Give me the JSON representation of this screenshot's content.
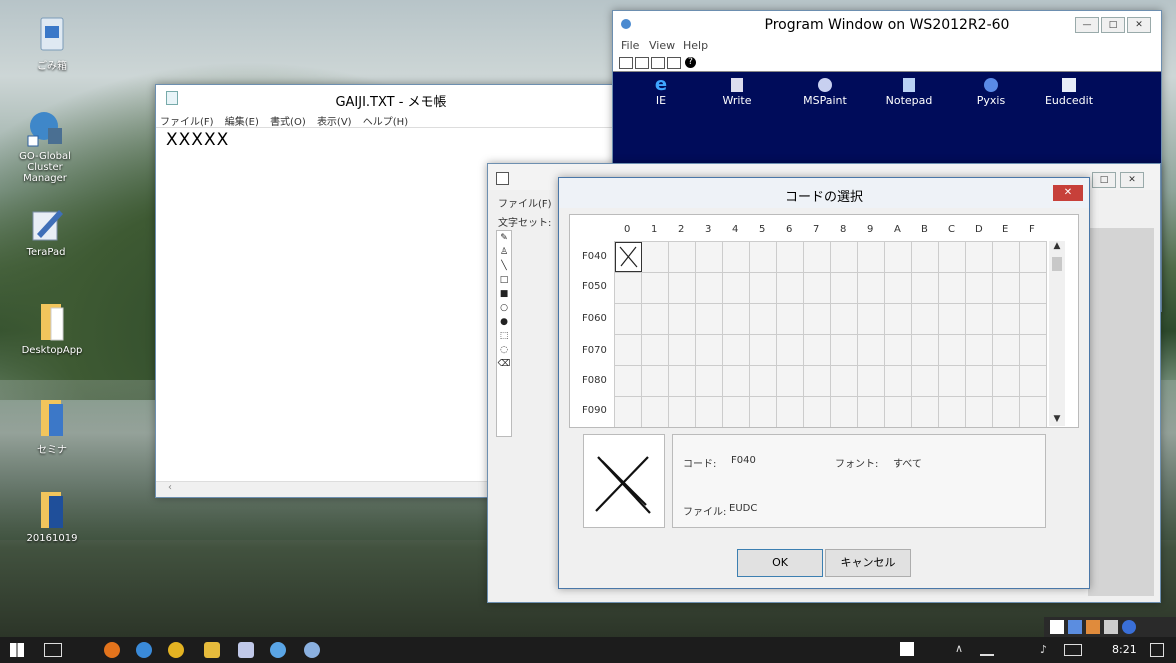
{
  "desktop": {
    "icons": [
      {
        "label": "ごみ箱",
        "icon": "recycle-bin-icon"
      },
      {
        "label": "GO-Global Cluster Manager",
        "icon": "cluster-manager-icon"
      },
      {
        "label": "TeraPad",
        "icon": "terapad-icon"
      },
      {
        "label": "DesktopApp",
        "icon": "folder-icon"
      },
      {
        "label": "セミナ",
        "icon": "folder-icon"
      },
      {
        "label": "20161019",
        "icon": "folder-icon"
      }
    ]
  },
  "notepad": {
    "title": "GAIJI.TXT - メモ帳",
    "menu": [
      "ファイル(F)",
      "編集(E)",
      "書式(O)",
      "表示(V)",
      "ヘルプ(H)"
    ],
    "content": "XXXXX"
  },
  "program_window": {
    "title": "Program Window on WS2012R2-60",
    "menu": [
      "File",
      "View",
      "Help"
    ],
    "apps": [
      "IE",
      "Write",
      "MSPaint",
      "Notepad",
      "Pyxis",
      "Eudcedit"
    ]
  },
  "eudc_window": {
    "menu_file": "ファイル(F)",
    "charset_label": "文字セット:"
  },
  "dialog": {
    "title": "コードの選択",
    "columns": [
      "0",
      "1",
      "2",
      "3",
      "4",
      "5",
      "6",
      "7",
      "8",
      "9",
      "A",
      "B",
      "C",
      "D",
      "E",
      "F"
    ],
    "rows": [
      "F040",
      "F050",
      "F060",
      "F070",
      "F080",
      "F090"
    ],
    "code_label": "コード:",
    "code_value": "F040",
    "font_label": "フォント:",
    "font_value": "すべて",
    "file_label": "ファイル:",
    "file_value": "EUDC",
    "ok_label": "OK",
    "cancel_label": "キャンセル"
  },
  "taskbar": {
    "time": "8:21"
  },
  "colors": {
    "program_bg": "#000c5a",
    "dialog_close": "#c7403a",
    "taskbar_bg": "#1c1c1c"
  }
}
